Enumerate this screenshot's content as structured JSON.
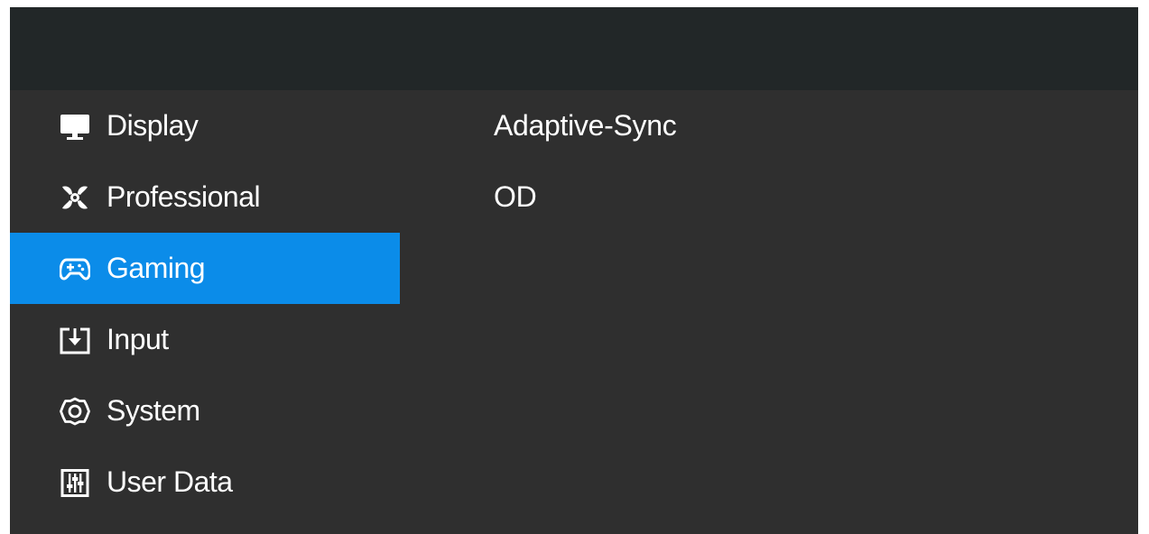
{
  "menu": {
    "items": [
      {
        "label": "Display",
        "icon": "monitor-icon"
      },
      {
        "label": "Professional",
        "icon": "pinwheel-icon"
      },
      {
        "label": "Gaming",
        "icon": "gamepad-icon",
        "active": true
      },
      {
        "label": "Input",
        "icon": "input-arrow-icon"
      },
      {
        "label": "System",
        "icon": "gear-icon"
      },
      {
        "label": "User Data",
        "icon": "sliders-icon"
      }
    ]
  },
  "submenu": {
    "items": [
      {
        "label": "Adaptive-Sync"
      },
      {
        "label": "OD"
      }
    ]
  },
  "colors": {
    "panel_background": "#2f2f2f",
    "header_background": "#222728",
    "active_highlight": "#0b8ce9",
    "text": "#ffffff"
  }
}
